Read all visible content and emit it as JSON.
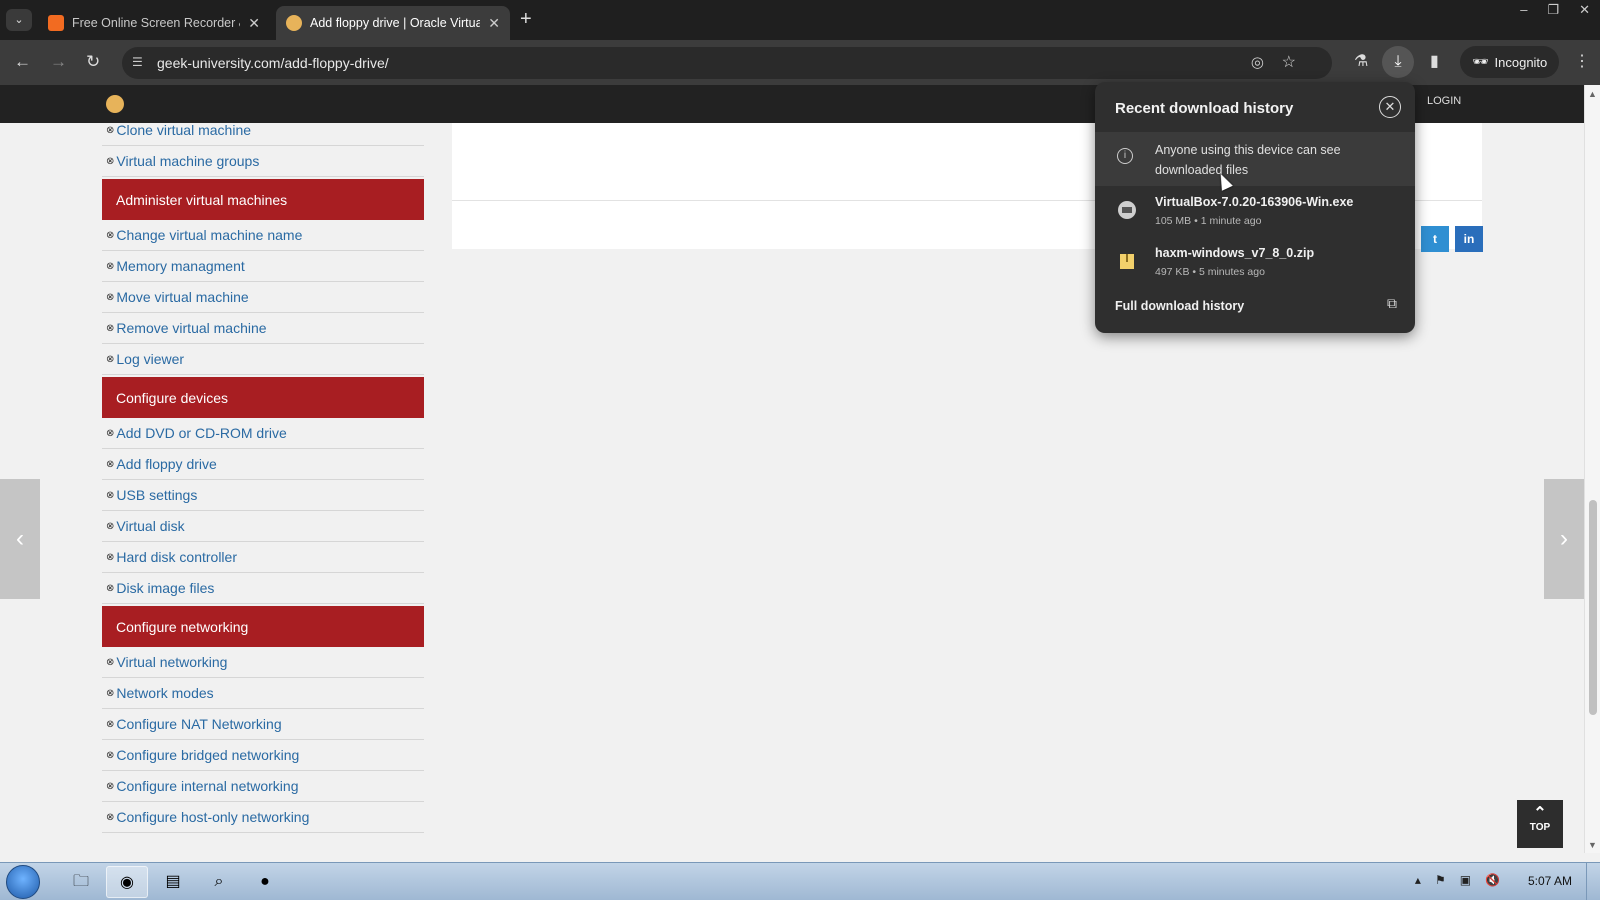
{
  "browser": {
    "tabs": [
      {
        "title": "Free Online Screen Recorder &",
        "active": false,
        "favicon_color": "#f26b21"
      },
      {
        "title": "Add floppy drive | Oracle Virtua",
        "active": true,
        "favicon_color": "#e7b35a"
      }
    ],
    "url": "geek-university.com/add-floppy-drive/",
    "incognito_label": "Incognito",
    "icons": [
      "back-icon",
      "forward-icon",
      "reload-icon",
      "site-info-icon",
      "eye-off-icon",
      "star-icon",
      "labs-icon",
      "download-icon",
      "side-panel-icon",
      "incognito-icon",
      "menu-icon"
    ]
  },
  "site": {
    "login_label": "LOGIN",
    "sidebar": [
      {
        "type": "link",
        "label": "Clone virtual machine"
      },
      {
        "type": "link",
        "label": "Virtual machine groups"
      },
      {
        "type": "section",
        "label": "Administer virtual machines"
      },
      {
        "type": "link",
        "label": "Change virtual machine name"
      },
      {
        "type": "link",
        "label": "Memory managment"
      },
      {
        "type": "link",
        "label": "Move virtual machine"
      },
      {
        "type": "link",
        "label": "Remove virtual machine"
      },
      {
        "type": "link",
        "label": "Log viewer"
      },
      {
        "type": "section",
        "label": "Configure devices"
      },
      {
        "type": "link",
        "label": "Add DVD or CD-ROM drive"
      },
      {
        "type": "link",
        "label": "Add floppy drive"
      },
      {
        "type": "link",
        "label": "USB settings"
      },
      {
        "type": "link",
        "label": "Virtual disk"
      },
      {
        "type": "link",
        "label": "Hard disk controller"
      },
      {
        "type": "link",
        "label": "Disk image files"
      },
      {
        "type": "section",
        "label": "Configure networking"
      },
      {
        "type": "link",
        "label": "Virtual networking"
      },
      {
        "type": "link",
        "label": "Network modes"
      },
      {
        "type": "link",
        "label": "Configure NAT Networking"
      },
      {
        "type": "link",
        "label": "Configure bridged networking"
      },
      {
        "type": "link",
        "label": "Configure internal networking"
      },
      {
        "type": "link",
        "label": "Configure host-only networking"
      }
    ],
    "top_button_label": "TOP",
    "colors": {
      "section": "#a81e22",
      "link": "#2a6aa3"
    }
  },
  "downloads": {
    "title": "Recent download history",
    "notice": "Anyone using this device can see downloaded files",
    "items": [
      {
        "name": "VirtualBox-7.0.20-163906-Win.exe",
        "meta": "105 MB • 1 minute ago",
        "icon": "installer-icon"
      },
      {
        "name": "haxm-windows_v7_8_0.zip",
        "meta": "497 KB • 5 minutes ago",
        "icon": "zip-folder-icon"
      }
    ],
    "full_history_label": "Full download history"
  },
  "taskbar": {
    "clock": "5:07 AM",
    "apps": [
      "explorer-icon",
      "chrome-icon",
      "notepad-icon",
      "search-tool-icon",
      "obs-icon"
    ]
  }
}
